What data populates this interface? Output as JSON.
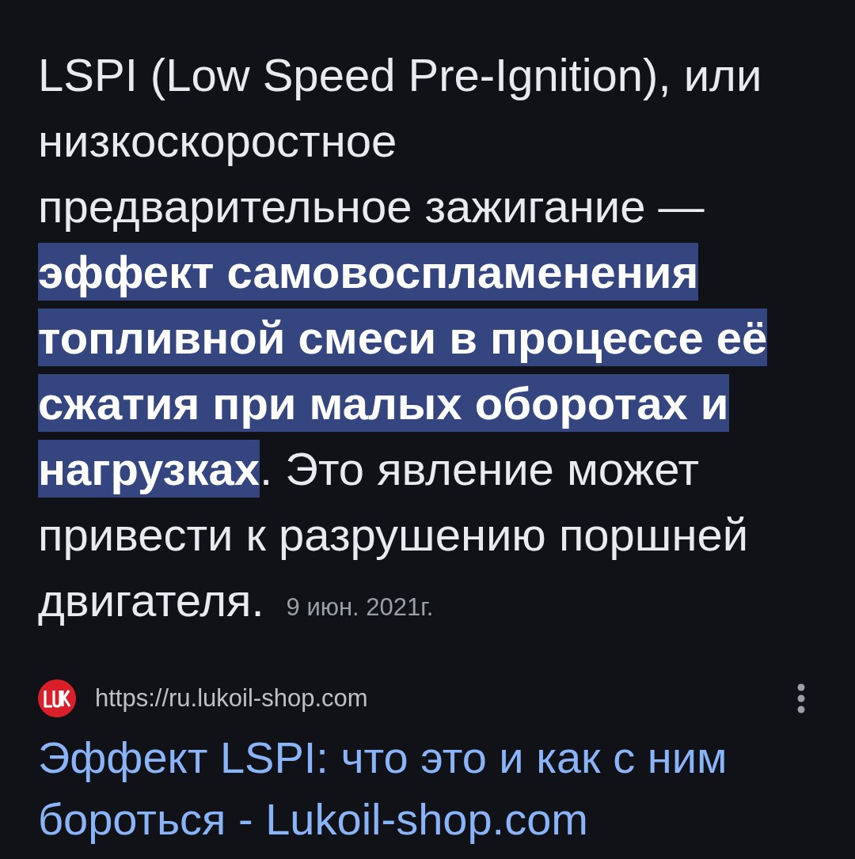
{
  "snippet": {
    "text": "LSPI (Low Speed Pre-Ignition), или низкоскоростное предварительное зажигание — **эффект самовоспламенения топливной смеси в процессе её сжатия при малых оборотах и нагрузках**. Это явление может привести к разрушению поршней двигателя.",
    "date": "9 июн. 2021г."
  },
  "source": {
    "url": "https://ru.lukoil-shop.com",
    "title": "Эффект LSPI: что это и как с ним бороться - Lukoil-shop.com"
  }
}
